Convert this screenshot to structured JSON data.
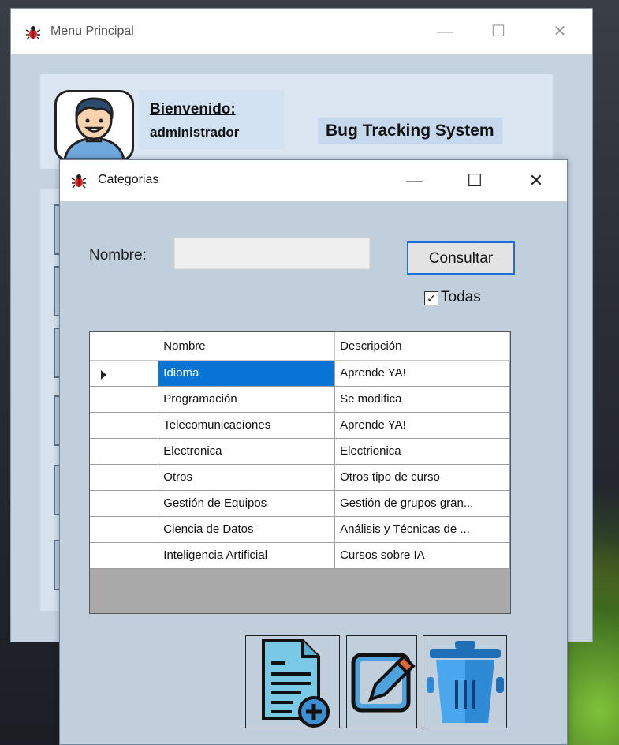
{
  "main_window": {
    "title": "Menu Principal",
    "welcome": "Bienvenido:",
    "user": "administrador",
    "system_title": "Bug Tracking System"
  },
  "dialog": {
    "title": "Categorias",
    "nombre_label": "Nombre:",
    "nombre_value": "",
    "consultar_label": "Consultar",
    "todas_label": "Todas",
    "todas_checked": true
  },
  "grid": {
    "columns": [
      "Nombre",
      "Descripción"
    ],
    "rows": [
      {
        "nombre": "Idioma",
        "descripcion": "Aprende YA!"
      },
      {
        "nombre": "Programación",
        "descripcion": "Se modifica"
      },
      {
        "nombre": "Telecomunicacíones",
        "descripcion": "Aprende YA!"
      },
      {
        "nombre": "Electronica",
        "descripcion": "Electrionica"
      },
      {
        "nombre": "Otros",
        "descripcion": "Otros tipo de curso"
      },
      {
        "nombre": "Gestión de Equipos",
        "descripcion": "Gestión de grupos gran..."
      },
      {
        "nombre": "Ciencia de Datos",
        "descripcion": "Análisis y Técnicas de ..."
      },
      {
        "nombre": "Inteligencia Artificial",
        "descripcion": "Cursos sobre IA"
      }
    ],
    "selected_row": 0
  },
  "icons": {
    "app": "bug-icon",
    "add": "add-document-icon",
    "edit": "edit-icon",
    "delete": "trash-icon"
  },
  "colors": {
    "selection": "#0a74d6",
    "focus_border": "#1b6fd6",
    "form_bg": "#c1cfdc"
  }
}
